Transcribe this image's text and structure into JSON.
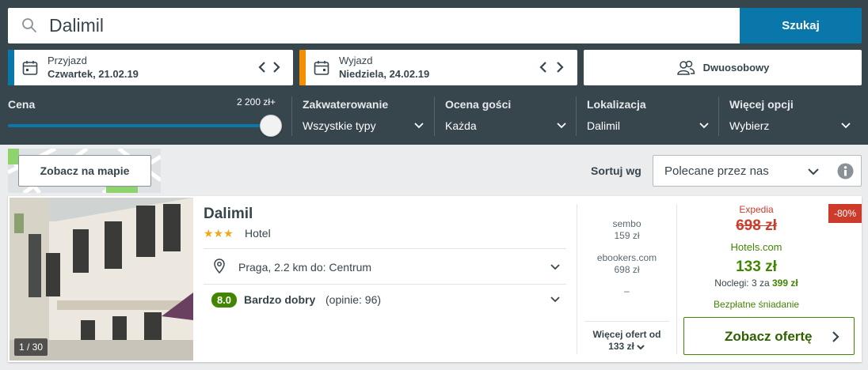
{
  "search": {
    "value": "Dalimil",
    "button": "Szukaj"
  },
  "checkin": {
    "label": "Przyjazd",
    "value": "Czwartek, 21.02.19",
    "accent": "#0a77ab"
  },
  "checkout": {
    "label": "Wyjazd",
    "value": "Niedziela, 24.02.19",
    "accent": "#f48f00"
  },
  "room": {
    "label": "Dwuosobowy"
  },
  "filters": {
    "price": {
      "label": "Cena",
      "max_label": "2 200 zł+",
      "fill_fraction": 1.0
    },
    "accommodation": {
      "label": "Zakwaterowanie",
      "value": "Wszystkie typy"
    },
    "rating": {
      "label": "Ocena gości",
      "value": "Każda"
    },
    "location": {
      "label": "Lokalizacja",
      "value": "Dalimil"
    },
    "more": {
      "label": "Więcej opcji",
      "value": "Wybierz"
    }
  },
  "map_button": "Zobacz na mapie",
  "sort": {
    "label": "Sortuj wg",
    "value": "Polecane przez nas"
  },
  "hotel": {
    "name": "Dalimil",
    "stars": "★★★",
    "star_count": 3,
    "type": "Hotel",
    "photo_count": "1 / 30",
    "location": "Praga, 2.2 km do: Centrum",
    "rating_score": "8.0",
    "rating_word": "Bardzo dobry",
    "rating_count": "(opinie: 96)",
    "alt_offers": [
      {
        "site": "sembo",
        "price": "159 zł"
      },
      {
        "site": "ebookers.com",
        "price": "698 zł"
      },
      {
        "site": "–",
        "price": ""
      }
    ],
    "more_offers_line1": "Więcej ofert od",
    "more_offers_line2": "133 zł",
    "deal": {
      "badge": "-80%",
      "compare_site": "Expedia",
      "compare_price": "698 zł",
      "site": "Hotels.com",
      "price": "133 zł",
      "nights_text": "Noclegi: 3 za",
      "nights_total": "399 zł",
      "perk": "Bezpłatne śniadanie",
      "cta": "Zobacz ofertę"
    }
  },
  "colors": {
    "header_bg": "#37454d",
    "accent_blue": "#0a77ab",
    "green": "#428500",
    "red": "#cd3b2b",
    "star": "#f0a818"
  }
}
